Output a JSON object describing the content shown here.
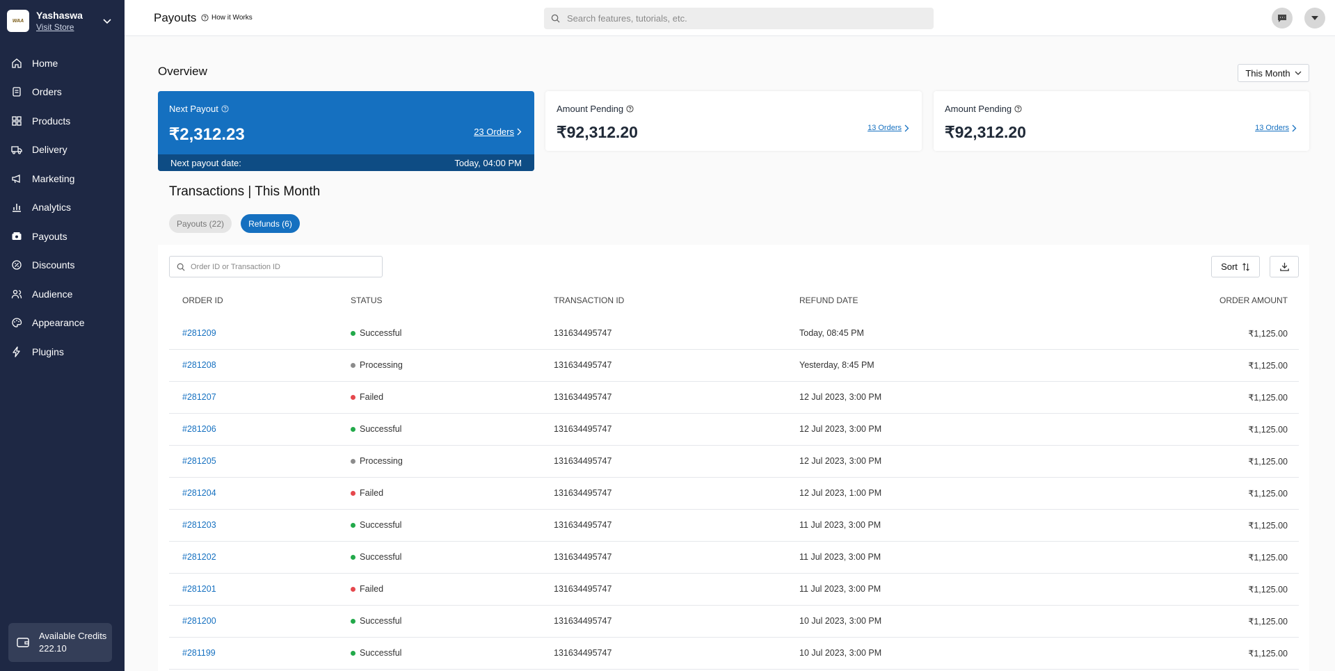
{
  "store": {
    "name": "Yashaswa",
    "link": "Visit Store",
    "logo_text": "WAA"
  },
  "nav": [
    {
      "label": "Home",
      "icon": "home-icon"
    },
    {
      "label": "Orders",
      "icon": "orders-icon"
    },
    {
      "label": "Products",
      "icon": "products-icon"
    },
    {
      "label": "Delivery",
      "icon": "truck-icon"
    },
    {
      "label": "Marketing",
      "icon": "megaphone-icon"
    },
    {
      "label": "Analytics",
      "icon": "analytics-icon"
    },
    {
      "label": "Payouts",
      "icon": "payouts-icon"
    },
    {
      "label": "Discounts",
      "icon": "discount-icon"
    },
    {
      "label": "Audience",
      "icon": "audience-icon"
    },
    {
      "label": "Appearance",
      "icon": "palette-icon"
    },
    {
      "label": "Plugins",
      "icon": "bolt-icon"
    }
  ],
  "credits": {
    "label": "Available Credits",
    "value": "222.10"
  },
  "header": {
    "title": "Payouts",
    "how_it_works": "How it Works",
    "search_placeholder": "Search features, tutorials, etc."
  },
  "overview": {
    "title": "Overview",
    "period": "This Month",
    "next_payout": {
      "label": "Next Payout",
      "amount": "₹2,312.23",
      "orders": "23 Orders",
      "date_label": "Next payout date:",
      "date_value": "Today, 04:00 PM"
    },
    "pending_1": {
      "label": "Amount Pending",
      "amount": "₹92,312.20",
      "orders": "13 Orders"
    },
    "pending_2": {
      "label": "Amount Pending",
      "amount": "₹92,312.20",
      "orders": "13 Orders"
    }
  },
  "transactions": {
    "title": "Transactions | This Month",
    "tabs": [
      {
        "label": "Payouts (22)",
        "active": false
      },
      {
        "label": "Refunds (6)",
        "active": true
      }
    ],
    "search_placeholder": "Order ID or Transaction ID",
    "sort_label": "Sort",
    "columns": [
      "Order ID",
      "Status",
      "Transaction ID",
      "Refund Date",
      "Order Amount"
    ],
    "status_colors": {
      "Successful": "#22a94a",
      "Processing": "#8c8c8c",
      "Failed": "#e5484d"
    },
    "rows": [
      {
        "order": "#281209",
        "status": "Successful",
        "txn": "131634495747",
        "date": "Today, 08:45 PM",
        "amount": "₹1,125.00"
      },
      {
        "order": "#281208",
        "status": "Processing",
        "txn": "131634495747",
        "date": "Yesterday, 8:45 PM",
        "amount": "₹1,125.00"
      },
      {
        "order": "#281207",
        "status": "Failed",
        "txn": "131634495747",
        "date": "12 Jul 2023, 3:00 PM",
        "amount": "₹1,125.00"
      },
      {
        "order": "#281206",
        "status": "Successful",
        "txn": "131634495747",
        "date": "12 Jul 2023, 3:00 PM",
        "amount": "₹1,125.00"
      },
      {
        "order": "#281205",
        "status": "Processing",
        "txn": "131634495747",
        "date": "12 Jul 2023, 3:00 PM",
        "amount": "₹1,125.00"
      },
      {
        "order": "#281204",
        "status": "Failed",
        "txn": "131634495747",
        "date": "12 Jul 2023, 1:00 PM",
        "amount": "₹1,125.00"
      },
      {
        "order": "#281203",
        "status": "Successful",
        "txn": "131634495747",
        "date": "11 Jul 2023, 3:00 PM",
        "amount": "₹1,125.00"
      },
      {
        "order": "#281202",
        "status": "Successful",
        "txn": "131634495747",
        "date": "11 Jul 2023, 3:00 PM",
        "amount": "₹1,125.00"
      },
      {
        "order": "#281201",
        "status": "Failed",
        "txn": "131634495747",
        "date": "11 Jul 2023, 3:00 PM",
        "amount": "₹1,125.00"
      },
      {
        "order": "#281200",
        "status": "Successful",
        "txn": "131634495747",
        "date": "10 Jul 2023, 3:00 PM",
        "amount": "₹1,125.00"
      },
      {
        "order": "#281199",
        "status": "Successful",
        "txn": "131634495747",
        "date": "10 Jul 2023, 3:00 PM",
        "amount": "₹1,125.00"
      }
    ]
  }
}
